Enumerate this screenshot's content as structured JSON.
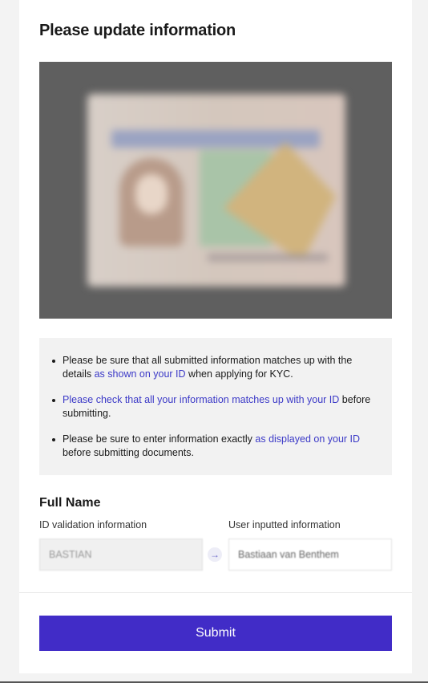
{
  "title": "Please update information",
  "instructions": [
    {
      "pre": "Please be sure that all submitted information matches up with the details ",
      "link": "as shown on your ID",
      "post": " when applying for KYC."
    },
    {
      "pre": "",
      "link": "Please check that all your information matches up with your ID",
      "post": " before submitting."
    },
    {
      "pre": "Please be sure to enter information exactly ",
      "link": "as displayed on your ID",
      "post": " before submitting documents."
    }
  ],
  "section": {
    "title": "Full Name",
    "left_label": "ID validation information",
    "right_label": "User inputted information",
    "left_value": "BASTIAN",
    "right_value": "Bastiaan van Benthem"
  },
  "submit_label": "Submit",
  "colors": {
    "accent": "#412cc7",
    "link": "#3b39c7"
  },
  "icons": {
    "arrow": "arrow-right-icon",
    "id_image": "id-document-image"
  }
}
